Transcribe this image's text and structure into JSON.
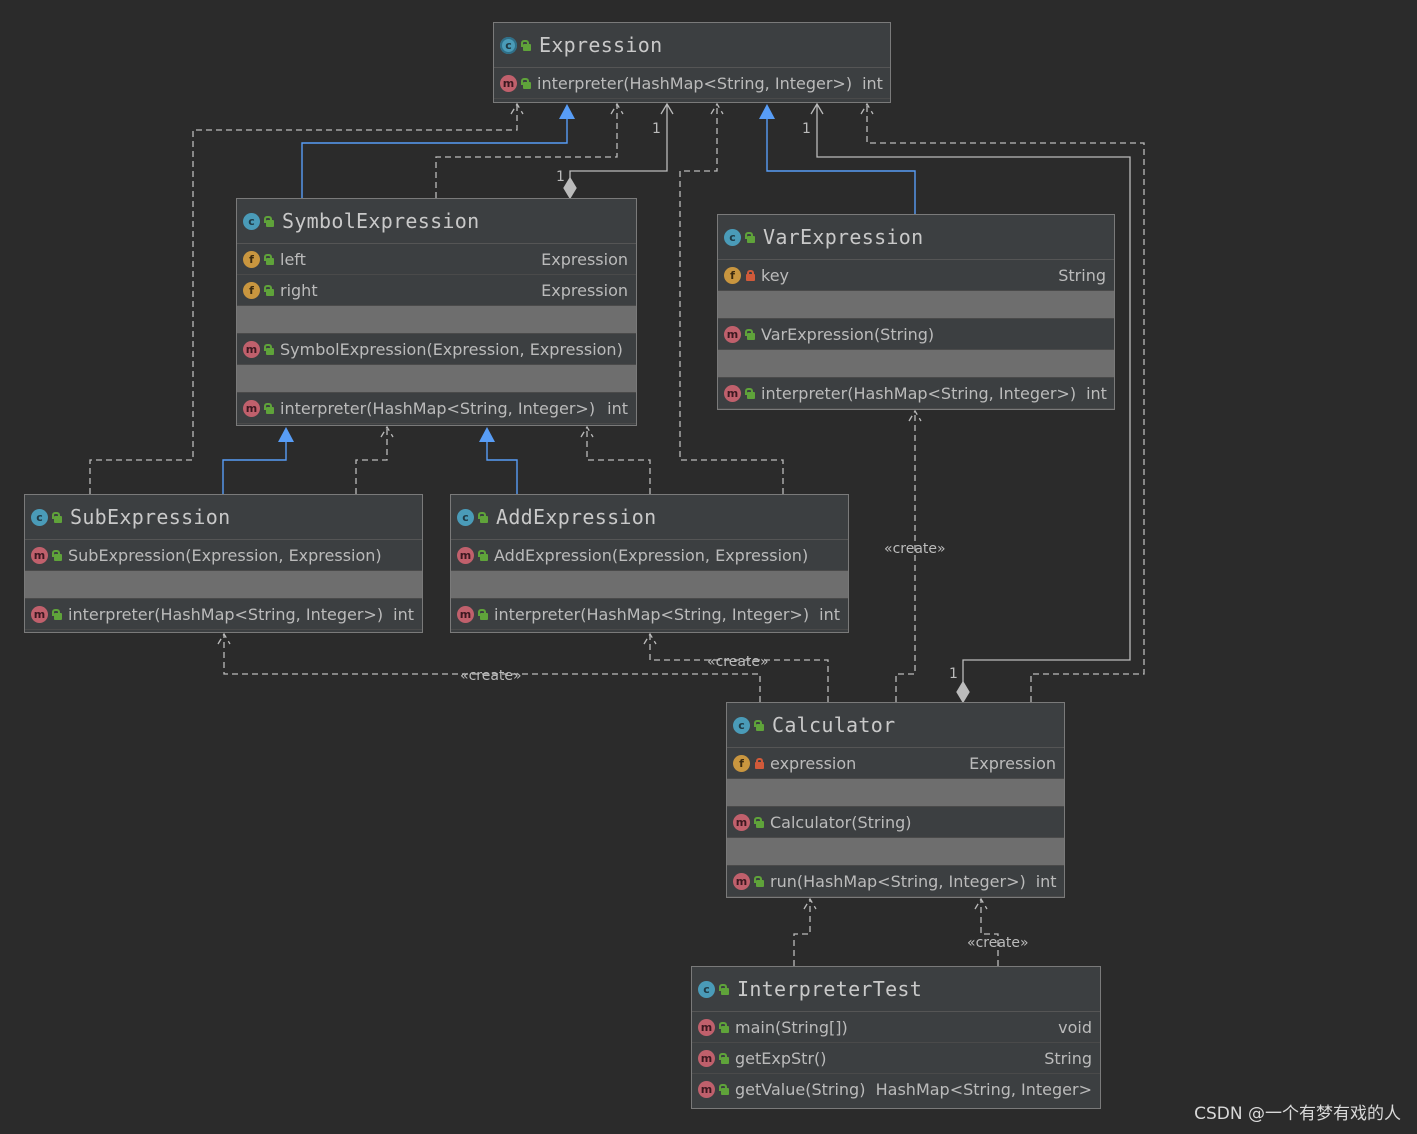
{
  "classes": {
    "expression": {
      "name": "Expression",
      "methods": [
        {
          "name": "interpreter(HashMap<String, Integer>)",
          "type": "int"
        }
      ]
    },
    "symbol": {
      "name": "SymbolExpression",
      "fields": [
        {
          "name": "left",
          "type": "Expression"
        },
        {
          "name": "right",
          "type": "Expression"
        }
      ],
      "constructors": [
        {
          "name": "SymbolExpression(Expression, Expression)"
        }
      ],
      "methods": [
        {
          "name": "interpreter(HashMap<String, Integer>)",
          "type": "int"
        }
      ]
    },
    "var": {
      "name": "VarExpression",
      "fields": [
        {
          "name": "key",
          "type": "String"
        }
      ],
      "constructors": [
        {
          "name": "VarExpression(String)"
        }
      ],
      "methods": [
        {
          "name": "interpreter(HashMap<String, Integer>)",
          "type": "int"
        }
      ]
    },
    "sub": {
      "name": "SubExpression",
      "constructors": [
        {
          "name": "SubExpression(Expression, Expression)"
        }
      ],
      "methods": [
        {
          "name": "interpreter(HashMap<String, Integer>)",
          "type": "int"
        }
      ]
    },
    "add": {
      "name": "AddExpression",
      "constructors": [
        {
          "name": "AddExpression(Expression, Expression)"
        }
      ],
      "methods": [
        {
          "name": "interpreter(HashMap<String, Integer>)",
          "type": "int"
        }
      ]
    },
    "calc": {
      "name": "Calculator",
      "fields": [
        {
          "name": "expression",
          "type": "Expression"
        }
      ],
      "constructors": [
        {
          "name": "Calculator(String)"
        }
      ],
      "methods": [
        {
          "name": "run(HashMap<String, Integer>)",
          "type": "int"
        }
      ]
    },
    "test": {
      "name": "InterpreterTest",
      "methods": [
        {
          "name": "main(String[])",
          "type": "void"
        },
        {
          "name": "getExpStr()",
          "type": "String"
        },
        {
          "name": "getValue(String)",
          "type": "HashMap<String, Integer>"
        }
      ]
    }
  },
  "labels": {
    "create": "«create»",
    "one": "1"
  },
  "icons": {
    "class": "class-icon",
    "abstract_class": "abstract-class-icon",
    "field": "field-icon",
    "method": "method-icon",
    "public": "public-lock-icon",
    "private": "private-lock-icon"
  },
  "colors": {
    "background": "#2b2b2b",
    "box": "#3c3f41",
    "inheritance": "#589df6",
    "dependency": "#bbbbbb",
    "separator": "#6e6e6e"
  },
  "watermark": "CSDN @一个有梦有戏的人"
}
